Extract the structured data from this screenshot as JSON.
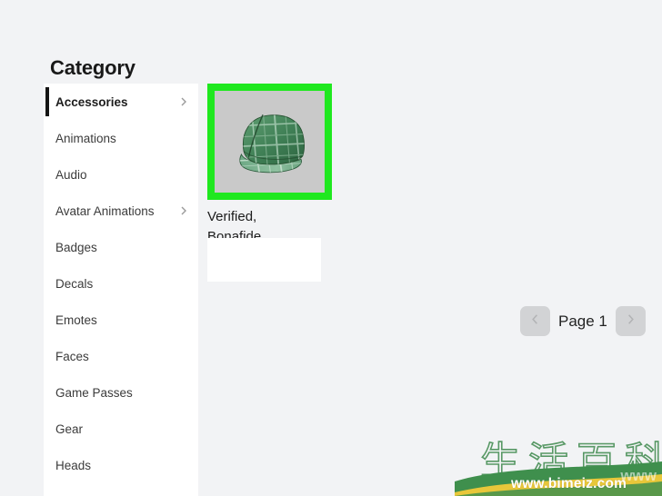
{
  "page": {
    "background_color": "#f2f3f5",
    "panel_color": "#ffffff",
    "title": "Category"
  },
  "sidebar": {
    "heading": "Category",
    "active_index": 0,
    "active_bar_color": "#141414",
    "items": [
      {
        "label": "Accessories",
        "has_chevron": true,
        "active": true
      },
      {
        "label": "Animations",
        "has_chevron": false,
        "active": false
      },
      {
        "label": "Audio",
        "has_chevron": false,
        "active": false
      },
      {
        "label": "Avatar Animations",
        "has_chevron": true,
        "active": false
      },
      {
        "label": "Badges",
        "has_chevron": false,
        "active": false
      },
      {
        "label": "Decals",
        "has_chevron": false,
        "active": false
      },
      {
        "label": "Emotes",
        "has_chevron": false,
        "active": false
      },
      {
        "label": "Faces",
        "has_chevron": false,
        "active": false
      },
      {
        "label": "Game Passes",
        "has_chevron": false,
        "active": false
      },
      {
        "label": "Gear",
        "has_chevron": false,
        "active": false
      },
      {
        "label": "Heads",
        "has_chevron": false,
        "active": false
      }
    ],
    "chevron_icon": "chevron-right-icon"
  },
  "results": {
    "cards": [
      {
        "title": "Verified,\nBonafide,",
        "title_line1": "Verified,",
        "title_line2": "Bonafide,",
        "thumbnail_alt": "green-plaid-cadet-cap",
        "highlight_color": "#1fe81f",
        "thumbnail_background": "#c9c9c9",
        "selected": true
      }
    ]
  },
  "pagination": {
    "prev_icon": "chevron-left-icon",
    "next_icon": "chevron-right-icon",
    "label": "Page 1",
    "page_number": 1,
    "button_color": "#d2d3d5",
    "icon_color": "#b2b3b5"
  },
  "watermark": {
    "characters": "生活百科",
    "url": "www.bimeiz.com",
    "ghost_text": "www",
    "stroke_color": "#4b9159",
    "swoosh_green": "#3f8f4d",
    "swoosh_yellow": "#e8c73a"
  }
}
